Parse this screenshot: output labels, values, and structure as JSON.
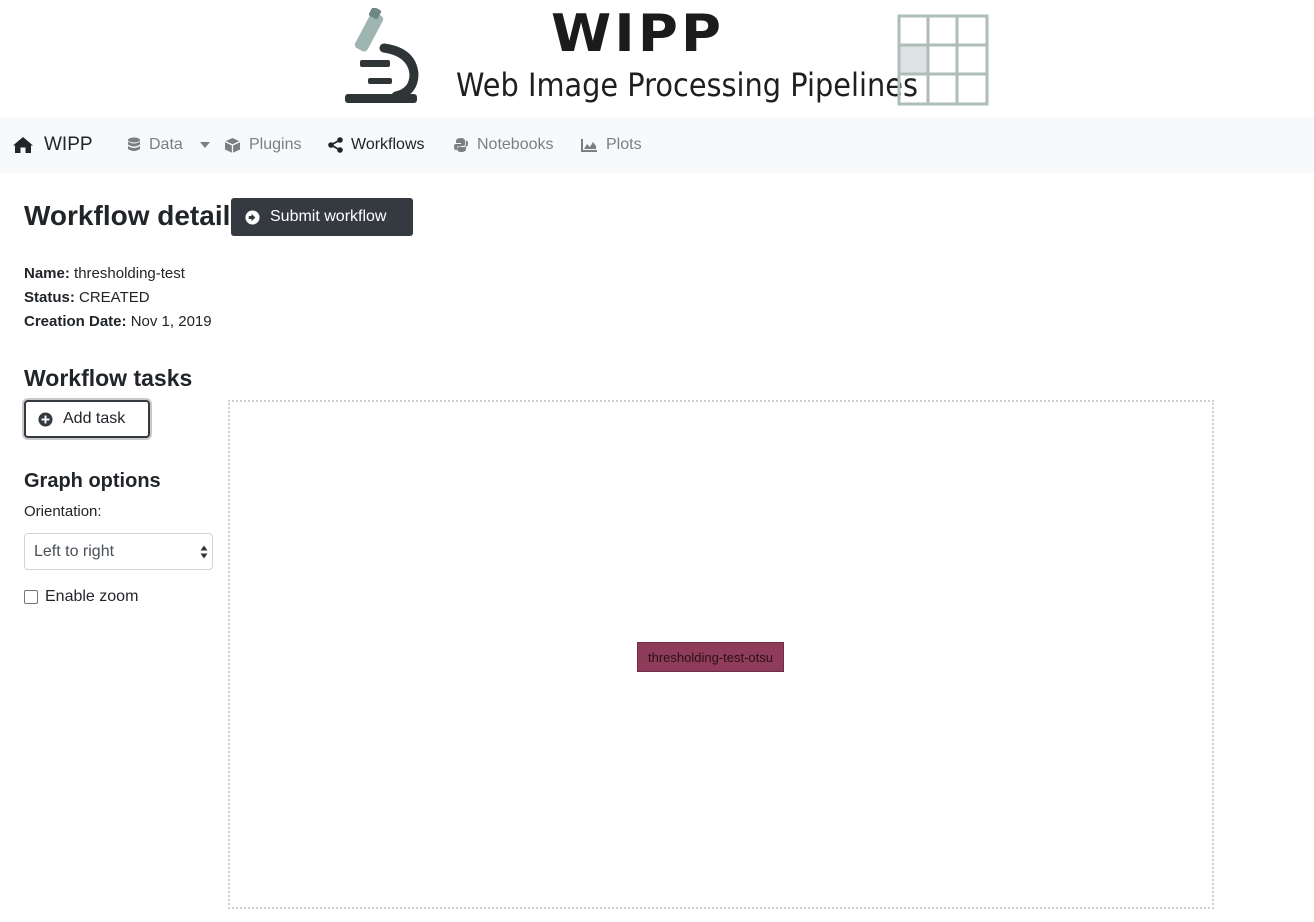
{
  "banner": {
    "title": "WIPP",
    "subtitle": "Web Image Processing Pipelines"
  },
  "navbar": {
    "brand": "WIPP",
    "items": [
      {
        "label": "Data",
        "icon": "database-icon",
        "dropdown": true
      },
      {
        "label": "Plugins",
        "icon": "cube-icon"
      },
      {
        "label": "Workflows",
        "icon": "share-icon",
        "active": true
      },
      {
        "label": "Notebooks",
        "icon": "python-icon"
      },
      {
        "label": "Plots",
        "icon": "chart-area-icon"
      }
    ]
  },
  "main": {
    "title": "Workflow detail",
    "submit_label": "Submit workflow",
    "name_label": "Name:",
    "name_value": "thresholding-test",
    "status_label": "Status:",
    "status_value": "CREATED",
    "date_label": "Creation Date:",
    "date_value": "Nov 1, 2019",
    "tasks_heading": "Workflow tasks",
    "add_task_label": "Add task",
    "graph_heading": "Graph options",
    "orientation_label": "Orientation:",
    "orientation_value": "Left to right",
    "zoom_label": "Enable zoom",
    "zoom_checked": false
  },
  "graph": {
    "nodes": [
      {
        "label": "thresholding-test-otsu",
        "color": "#8e3c59"
      }
    ]
  },
  "colors": {
    "navbar_bg": "#f8f9fa",
    "button_dark": "#343a40",
    "node": "#8e3c59",
    "logo_accent": "#9fb5b2"
  }
}
